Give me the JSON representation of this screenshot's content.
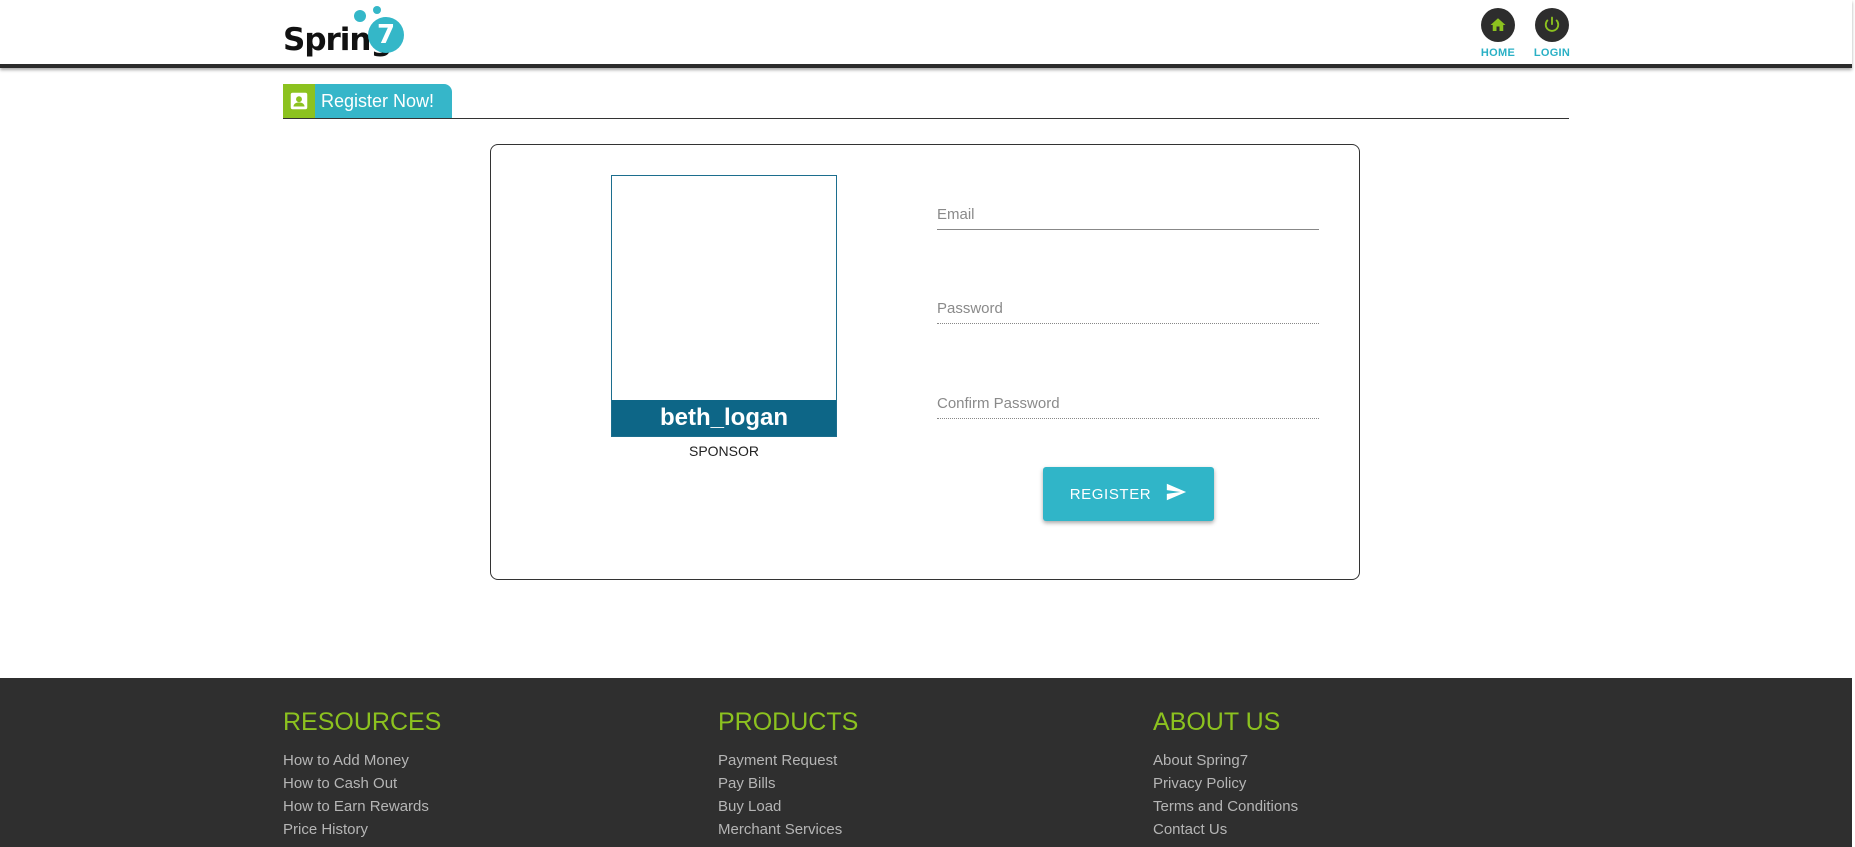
{
  "header": {
    "logo_text": "Spring",
    "logo_number": "7",
    "nav": [
      {
        "label": "HOME",
        "icon": "home-icon"
      },
      {
        "label": "LOGIN",
        "icon": "power-icon"
      }
    ]
  },
  "section_tab": {
    "label": "Register Now!",
    "icon": "account-box-icon"
  },
  "sponsor_card": {
    "username": "beth_logan",
    "caption": "SPONSOR"
  },
  "form": {
    "email": {
      "placeholder": "Email",
      "value": ""
    },
    "password": {
      "placeholder": "Password",
      "value": ""
    },
    "confirm_password": {
      "placeholder": "Confirm Password",
      "value": ""
    },
    "register_label": "REGISTER",
    "register_icon": "send-icon"
  },
  "footer": {
    "columns": [
      {
        "title": "RESOURCES",
        "links": [
          "How to Add Money",
          "How to Cash Out",
          "How to Earn Rewards",
          "Price History"
        ]
      },
      {
        "title": "PRODUCTS",
        "links": [
          "Payment Request",
          "Pay Bills",
          "Buy Load",
          "Merchant Services"
        ]
      },
      {
        "title": "ABOUT US",
        "links": [
          "About Spring7",
          "Privacy Policy",
          "Terms and Conditions",
          "Contact Us"
        ]
      }
    ]
  },
  "colors": {
    "accent_teal": "#30b5c8",
    "accent_green": "#8cc21f",
    "dark": "#2f2f2f",
    "name_bar": "#0d6687"
  }
}
